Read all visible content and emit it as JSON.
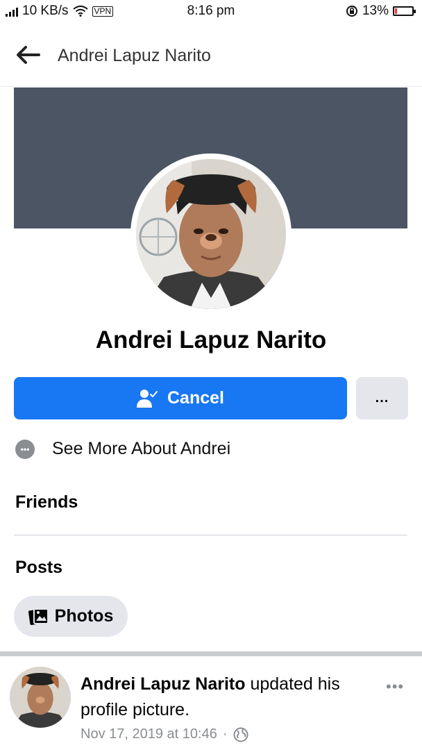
{
  "status_bar": {
    "speed": "10 KB/s",
    "vpn": "VPN",
    "time": "8:16 pm",
    "battery": "13%",
    "battery_level": 0.13
  },
  "header": {
    "back_icon": "arrow-left-icon",
    "title": "Andrei Lapuz Narito"
  },
  "profile": {
    "name": "Andrei Lapuz Narito",
    "cover_color": "#4b5563"
  },
  "actions": {
    "cancel_label": "Cancel",
    "more_label": "..."
  },
  "about": {
    "see_more_label": "See More About Andrei"
  },
  "sections": {
    "friends": "Friends",
    "posts": "Posts",
    "photos_chip": "Photos"
  },
  "post": {
    "author": "Andrei Lapuz Narito",
    "action": " updated his profile picture.",
    "date": "Nov 17, 2019 at 10:46",
    "separator": "·",
    "more": "•••"
  },
  "colors": {
    "primary": "#1877f2",
    "secondary_bg": "#e4e6eb",
    "muted": "#8a8d91"
  }
}
